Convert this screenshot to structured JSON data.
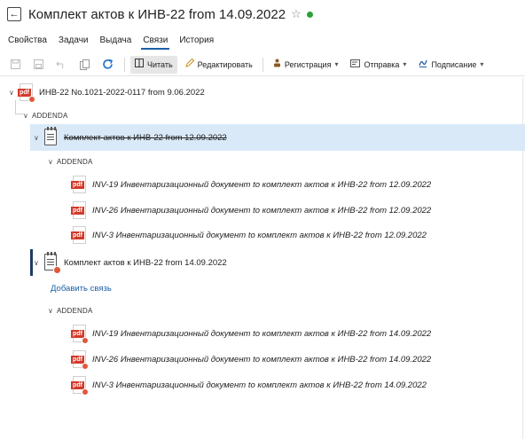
{
  "header": {
    "title": "Комплект актов к ИНВ-22 from 14.09.2022",
    "back_glyph": "←",
    "star_glyph": "☆",
    "status_color": "#2aa33a"
  },
  "tabs": [
    {
      "label": "Свойства"
    },
    {
      "label": "Задачи"
    },
    {
      "label": "Выдача"
    },
    {
      "label": "Связи"
    },
    {
      "label": "История"
    }
  ],
  "active_tab": "Связи",
  "toolbar": {
    "icons": [
      "save-icon",
      "save-as-icon",
      "undo-icon",
      "copy-icon",
      "refresh-icon"
    ],
    "read_label": "Читать",
    "edit_label": "Редактировать",
    "register_label": "Регистрация",
    "send_label": "Отправка",
    "sign_label": "Подписание"
  },
  "tree": {
    "root_doc": "ИНВ-22 No.1021-2022-0117 from 9.06.2022",
    "addenda_label": "ADDENDA",
    "group1": {
      "title": "Комплект актов к ИНВ-22 from 12.09.2022",
      "addenda_label": "ADDENDA",
      "items": [
        "INV-19 Инвентаризационный документ to комплект актов к ИНВ-22 from 12.09.2022",
        "INV-26 Инвентаризационный документ to комплект актов к ИНВ-22 from 12.09.2022",
        "INV-3 Инвентаризационный документ to комплект актов к ИНВ-22 from 12.09.2022"
      ]
    },
    "group2": {
      "title": "Комплект актов к ИНВ-22 from 14.09.2022",
      "add_link": "Добавить связь",
      "addenda_label": "ADDENDA",
      "items": [
        "INV-19 Инвентаризационный документ to комплект актов к ИНВ-22 from 14.09.2022",
        "INV-26 Инвентаризационный документ to комплект актов к ИНВ-22 from 14.09.2022",
        "INV-3 Инвентаризационный документ to комплект актов к ИНВ-22 from 14.09.2022"
      ]
    },
    "pdf_label": "pdf"
  }
}
